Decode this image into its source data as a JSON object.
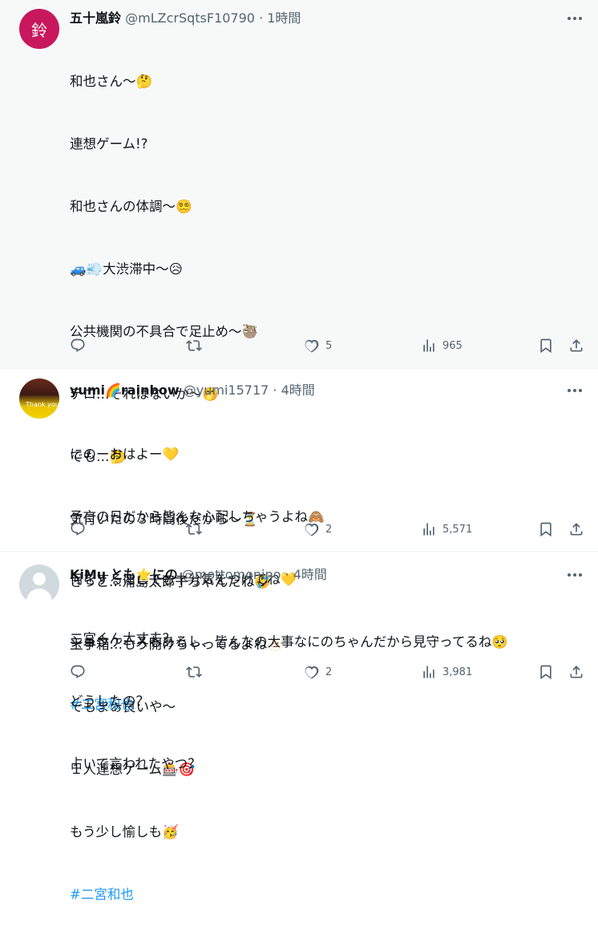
{
  "tweets": [
    {
      "avatar_text": "鈴",
      "name": "五十嵐鈴",
      "handle": "@mLZcrSqtsF10790",
      "sep": "·",
      "time": "1時間",
      "lines": [
        "和也さん〜🤔",
        "連想ゲーム!?",
        "和也さんの体調〜😵‍💫",
        "🚙💨大渋滞中〜😥",
        "公共機関の不具合で足止め〜🦥",
        "テロ…それはないか〜🤭",
        "でも…🤔",
        "気付いたの３時間後だから〜⏳",
        "きっと…浦島太郎子ちゃんだね🤣",
        "玉手箱…もう開けちゃってるよね🫥",
        "でもまぁ良いや〜",
        "１人連想ゲーム🎰🎯",
        "もう少し愉しも🥳"
      ],
      "hashtag": "#二宮和也",
      "replies": "",
      "retweets": "",
      "likes": "5",
      "views": "965"
    },
    {
      "name": "yumi🌈rainbow",
      "handle": "@yumi15717",
      "sep": "·",
      "time": "4時間",
      "avatar_text": "Thank you",
      "lines": [
        "にのーおはよー💛",
        "予言の日だから皆んな心配しちゃうよね🙈",
        "何をするにしても十分気をつけてね💛",
        "ショウケースもあるし、皆んなの大事なにのちゃんだから見守ってるね🥺"
      ],
      "hashtag": "#二宮和也",
      "replies": "",
      "retweets": "",
      "likes": "2",
      "views": "5,571"
    },
    {
      "name": "KiMu とも⭐にの",
      "handle": "@mottomonino",
      "sep": "·",
      "time": "4時間",
      "lines": [
        "二宮くん大丈夫？",
        "どうしたの？",
        "占いで言われたやつ？"
      ],
      "hashtag": "",
      "replies": "",
      "retweets": "",
      "likes": "2",
      "views": "3,981"
    }
  ],
  "icons": [
    "reply-icon",
    "retweet-icon",
    "like-icon",
    "views-icon",
    "bookmark-icon",
    "share-icon",
    "more-icon"
  ],
  "colors": {
    "hashtag": "#1d9bf0",
    "muted": "#536471",
    "avatar_red": "#c8175d"
  }
}
